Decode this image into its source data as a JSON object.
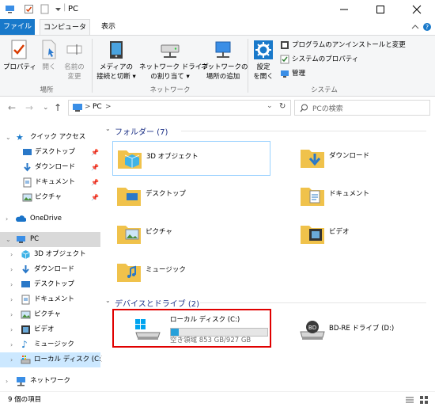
{
  "window": {
    "title": "PC"
  },
  "tabs": {
    "file": "ファイル",
    "computer": "コンピューター",
    "view": "表示"
  },
  "ribbon": {
    "properties": "プロパティ",
    "open": "開く",
    "rename_l1": "名前の",
    "rename_l2": "変更",
    "group_location": "場所",
    "media_l1": "メディアの",
    "media_l2": "接続と切断 ▾",
    "map_l1": "ネットワーク ドライブ",
    "map_l2": "の割り当て ▾",
    "addnet_l1": "ネットワークの",
    "addnet_l2": "場所の追加",
    "group_network": "ネットワーク",
    "settings_l1": "設定",
    "settings_l2": "を開く",
    "uninstall": "プログラムのアンインストールと変更",
    "sysprops": "システムのプロパティ",
    "manage": "管理",
    "group_system": "システム"
  },
  "address": {
    "path": "PC",
    "sep": ">",
    "search_placeholder": "PCの検索"
  },
  "nav": {
    "quick_access": "クイック アクセス",
    "desktop": "デスクトップ",
    "downloads": "ダウンロード",
    "documents": "ドキュメント",
    "pictures": "ピクチャ",
    "onedrive": "OneDrive",
    "pc": "PC",
    "objects3d": "3D オブジェクト",
    "videos": "ビデオ",
    "music": "ミュージック",
    "local_disk": "ローカル ディスク (C:)",
    "network": "ネットワーク"
  },
  "content": {
    "folders_header": "フォルダー (7)",
    "folders": [
      "3D オブジェクト",
      "ダウンロード",
      "デスクトップ",
      "ドキュメント",
      "ピクチャ",
      "ビデオ",
      "ミュージック"
    ],
    "devices_header": "デバイスとドライブ (2)",
    "drive_c": {
      "name": "ローカル ディスク (C:)",
      "free": "空き領域 853 GB/927 GB",
      "used_fraction": 0.08
    },
    "drive_d": {
      "name": "BD-RE ドライブ (D:)",
      "badge": "BD"
    }
  },
  "status": {
    "count": "9 個の項目"
  },
  "colors": {
    "accent": "#1979ca",
    "highlight": "#e00000",
    "folder": "#f0c24b",
    "group_header": "#1e3287"
  }
}
